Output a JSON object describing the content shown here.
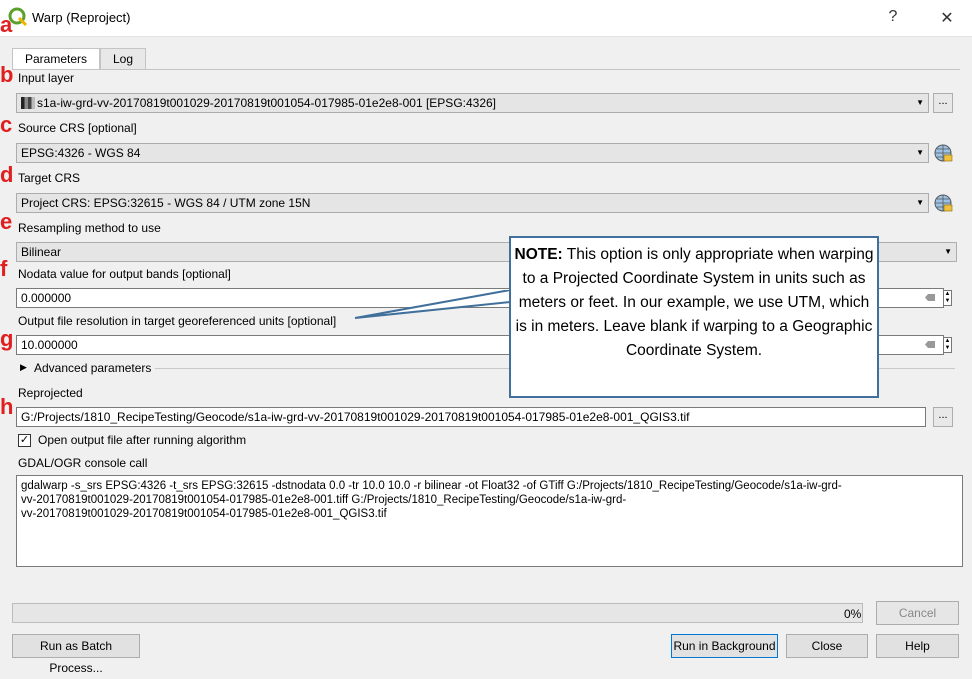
{
  "window": {
    "title": "Warp (Reproject)",
    "help_glyph": "?",
    "close_glyph": "✕"
  },
  "tabs": [
    {
      "label": "Parameters"
    },
    {
      "label": "Log"
    }
  ],
  "params": {
    "input_layer_label": "Input layer",
    "input_layer_value": "s1a-iw-grd-vv-20170819t001029-20170819t001054-017985-01e2e8-001 [EPSG:4326]",
    "source_crs_label": "Source CRS [optional]",
    "source_crs_value": "EPSG:4326 - WGS 84",
    "target_crs_label": "Target CRS",
    "target_crs_value": "Project CRS: EPSG:32615 - WGS 84 / UTM zone 15N",
    "resampling_label": "Resampling method to use",
    "resampling_value": "Bilinear",
    "nodata_label": "Nodata value for output bands [optional]",
    "nodata_value": "0.000000",
    "resolution_label": "Output file resolution in target georeferenced units [optional]",
    "resolution_value": "10.000000",
    "advanced_label": "Advanced parameters",
    "reprojected_label": "Reprojected",
    "reprojected_value": "G:/Projects/1810_RecipeTesting/Geocode/s1a-iw-grd-vv-20170819t001029-20170819t001054-017985-01e2e8-001_QGIS3.tif",
    "open_output_label": "Open output file after running algorithm",
    "console_label": "GDAL/OGR console call",
    "console_text": "gdalwarp -s_srs EPSG:4326 -t_srs EPSG:32615 -dstnodata 0.0 -tr 10.0 10.0 -r bilinear -ot Float32 -of GTiff G:/Projects/1810_RecipeTesting/Geocode/s1a-iw-grd-\nvv-20170819t001029-20170819t001054-017985-01e2e8-001.tiff G:/Projects/1810_RecipeTesting/Geocode/s1a-iw-grd-\nvv-20170819t001029-20170819t001054-017985-01e2e8-001_QGIS3.tif",
    "dots": "..."
  },
  "annotations": {
    "letters": [
      "a",
      "b",
      "c",
      "d",
      "e",
      "f",
      "g",
      "h"
    ],
    "note_bold": "NOTE:",
    "note_text": " This option is only appropriate when warping to a Projected Coordinate System in units such as meters or feet. In our example, we use UTM, which is in meters. Leave blank if warping to a Geographic Coordinate System."
  },
  "footer": {
    "progress_percent": 0,
    "progress_text": "0%",
    "cancel": "Cancel",
    "batch": "Run as Batch Process...",
    "run_bg": "Run in Background",
    "close": "Close",
    "help": "Help"
  },
  "colors": {
    "annotation_letter": "#e02020",
    "note_border": "#41709c",
    "qgis_green": "#5aa02c"
  }
}
